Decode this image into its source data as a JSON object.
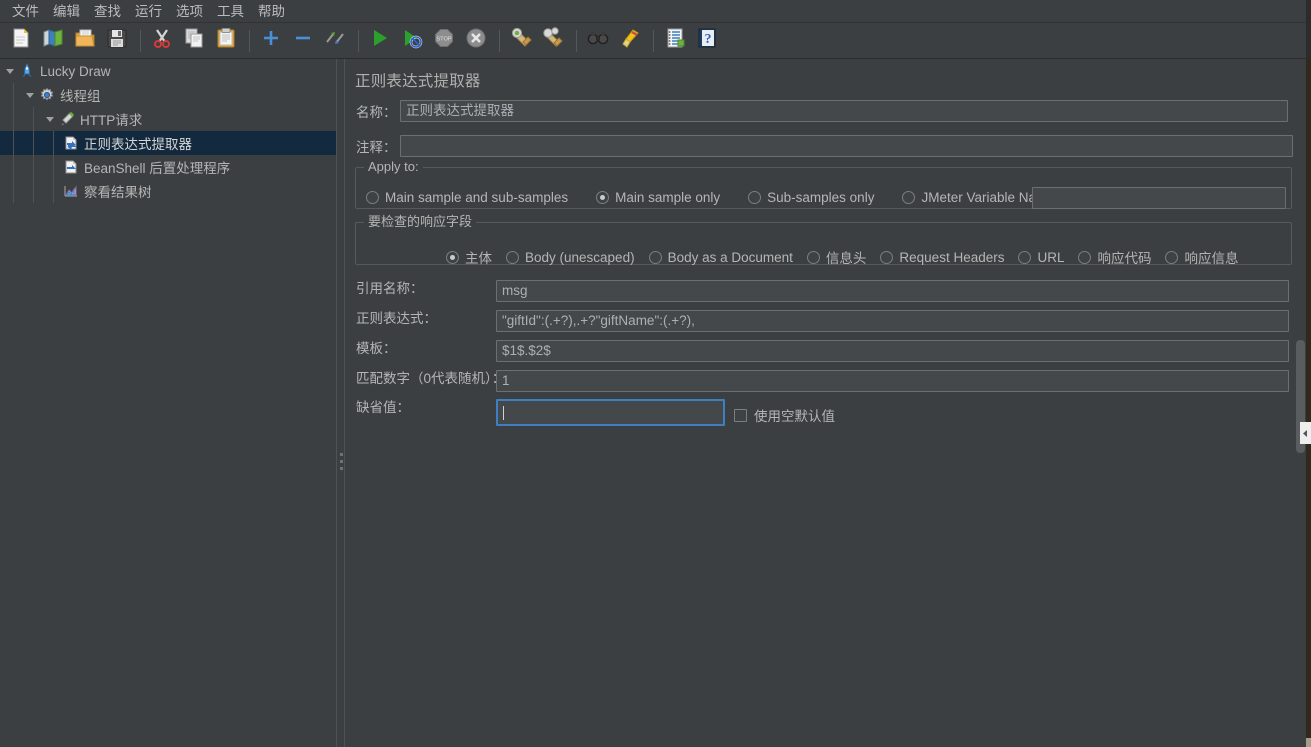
{
  "menubar": {
    "items": [
      {
        "label": "文件",
        "name": "menu-file"
      },
      {
        "label": "编辑",
        "name": "menu-edit"
      },
      {
        "label": "查找",
        "name": "menu-search"
      },
      {
        "label": "运行",
        "name": "menu-run"
      },
      {
        "label": "选项",
        "name": "menu-options"
      },
      {
        "label": "工具",
        "name": "menu-tools"
      },
      {
        "label": "帮助",
        "name": "menu-help"
      }
    ]
  },
  "toolbar": {
    "buttons": [
      {
        "icon": "new-file-icon",
        "label": "新建"
      },
      {
        "icon": "templates-icon",
        "label": "模板"
      },
      {
        "icon": "open-folder-icon",
        "label": "打开"
      },
      {
        "icon": "save-icon",
        "label": "保存"
      },
      {
        "icon": "cut-icon",
        "label": "剪切"
      },
      {
        "icon": "copy-icon",
        "label": "复制"
      },
      {
        "icon": "paste-icon",
        "label": "粘贴"
      },
      {
        "icon": "expand-all-icon",
        "label": "展开全部"
      },
      {
        "icon": "collapse-all-icon",
        "label": "折叠全部"
      },
      {
        "icon": "toggle-icon",
        "label": "启用/禁用"
      },
      {
        "icon": "start-icon",
        "label": "启动"
      },
      {
        "icon": "start-no-timers-icon",
        "label": "无间隔启动"
      },
      {
        "icon": "stop-icon",
        "label": "停止"
      },
      {
        "icon": "shutdown-icon",
        "label": "关闭"
      },
      {
        "icon": "clear-icon",
        "label": "清除"
      },
      {
        "icon": "clear-all-icon",
        "label": "清除全部"
      },
      {
        "icon": "search-icon",
        "label": "查找"
      },
      {
        "icon": "reset-search-icon",
        "label": "重置查找"
      },
      {
        "icon": "function-helper-icon",
        "label": "函数助手对话框"
      },
      {
        "icon": "help-icon",
        "label": "帮助"
      }
    ]
  },
  "tree": {
    "nodes": [
      {
        "label": "Lucky Draw",
        "icon": "jmeter-plan-icon",
        "depth": 0,
        "expanded": true,
        "selected": false
      },
      {
        "label": "线程组",
        "icon": "thread-group-icon",
        "depth": 1,
        "expanded": true,
        "selected": false
      },
      {
        "label": "HTTP请求",
        "icon": "http-request-icon",
        "depth": 2,
        "expanded": true,
        "selected": false
      },
      {
        "label": "正则表达式提取器",
        "icon": "post-processor-icon",
        "depth": 3,
        "expanded": null,
        "selected": true
      },
      {
        "label": "BeanShell 后置处理程序",
        "icon": "post-processor-icon",
        "depth": 3,
        "expanded": null,
        "selected": false
      },
      {
        "label": "察看结果树",
        "icon": "view-results-tree-icon",
        "depth": 3,
        "expanded": null,
        "selected": false
      }
    ]
  },
  "editor": {
    "panel_title": "正则表达式提取器",
    "name_label": "名称：",
    "name_value": "正则表达式提取器",
    "comment_label": "注释：",
    "comment_value": "",
    "apply_to": {
      "title": "Apply to:",
      "options": [
        {
          "label": "Main sample and sub-samples",
          "selected": false
        },
        {
          "label": "Main sample only",
          "selected": true
        },
        {
          "label": "Sub-samples only",
          "selected": false
        },
        {
          "label": "JMeter Variable Name to use",
          "selected": false
        }
      ],
      "variable_name_value": ""
    },
    "response_field": {
      "title": "要检查的响应字段",
      "options": [
        {
          "label": "主体",
          "selected": true
        },
        {
          "label": "Body (unescaped)",
          "selected": false
        },
        {
          "label": "Body as a Document",
          "selected": false
        },
        {
          "label": "信息头",
          "selected": false
        },
        {
          "label": "Request Headers",
          "selected": false
        },
        {
          "label": "URL",
          "selected": false
        },
        {
          "label": "响应代码",
          "selected": false
        },
        {
          "label": "响应信息",
          "selected": false
        }
      ]
    },
    "fields": [
      {
        "label": "引用名称：",
        "value": "msg",
        "name": "reference-name-input"
      },
      {
        "label": "正则表达式：",
        "value": "\"giftId\":(.+?),.+?\"giftName\":(.+?),",
        "name": "regex-input"
      },
      {
        "label": "模板：",
        "value": "$1$.$2$",
        "name": "template-input"
      },
      {
        "label": "匹配数字（0代表随机）：",
        "value": "1",
        "name": "match-number-input"
      },
      {
        "label": "缺省值：",
        "value": "",
        "name": "default-value-input"
      }
    ],
    "use_empty_default": {
      "label": "使用空默认值",
      "checked": false
    }
  },
  "colors": {
    "bg": "#3c3f41",
    "field_bg": "#45484a",
    "text": "#b5b5b5",
    "selection": "#13293d",
    "focus_border": "#3d7fc1"
  }
}
